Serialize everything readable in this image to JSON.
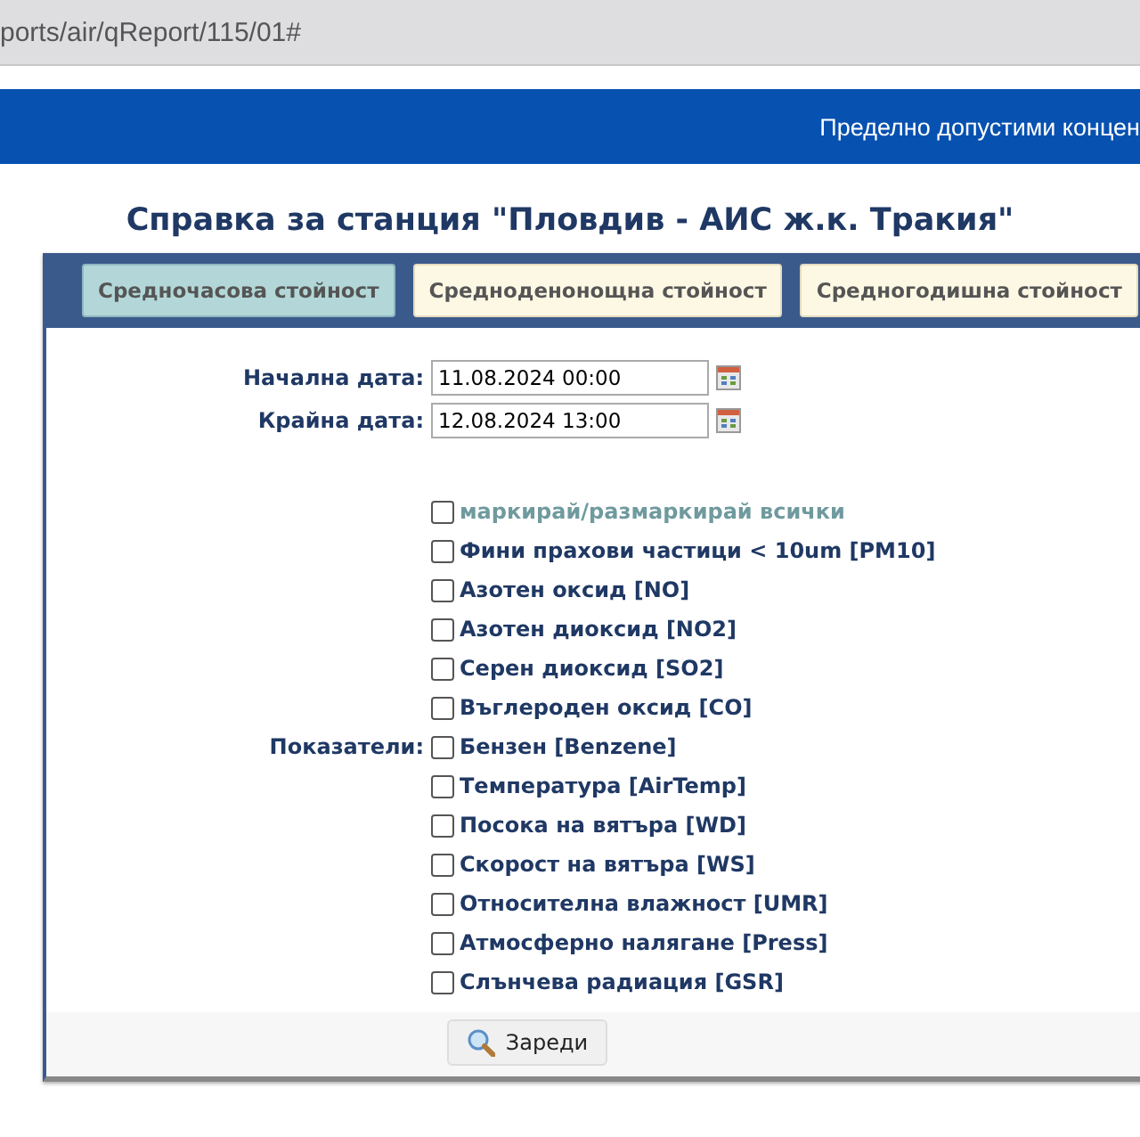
{
  "address_bar": {
    "url": "ports/air/qReport/115/01#"
  },
  "top_bar": {
    "text": "Пределно допустими концен"
  },
  "title": "Справка за станция \"Пловдив - АИС ж.к. Тракия\"",
  "tabs": [
    {
      "label": "Средночасова стойност",
      "selected": true
    },
    {
      "label": "Средноденонощна стойност",
      "selected": false
    },
    {
      "label": "Средногодишна стойност",
      "selected": false
    }
  ],
  "dates": [
    {
      "label": "Начална дата:",
      "value": "11.08.2024 00:00"
    },
    {
      "label": "Крайна дата:",
      "value": "12.08.2024 13:00"
    }
  ],
  "indicators": {
    "label": "Показатели:",
    "items": [
      {
        "label": "маркирай/размаркирай всички",
        "kind": "toggle-all",
        "checked": false
      },
      {
        "label": "Фини прахови частици < 10um [PM10]",
        "kind": "item",
        "checked": false
      },
      {
        "label": "Азотен оксид [NO]",
        "kind": "item",
        "checked": false
      },
      {
        "label": "Азотен диоксид [NO2]",
        "kind": "item",
        "checked": false
      },
      {
        "label": "Серен диоксид [SO2]",
        "kind": "item",
        "checked": false
      },
      {
        "label": "Въглероден оксид [CO]",
        "kind": "item",
        "checked": false
      },
      {
        "label": "Бензен [Benzene]",
        "kind": "item",
        "checked": false
      },
      {
        "label": "Температура [AirTemp]",
        "kind": "item",
        "checked": false
      },
      {
        "label": "Посока на вятъра [WD]",
        "kind": "item",
        "checked": false
      },
      {
        "label": "Скорост на вятъра [WS]",
        "kind": "item",
        "checked": false
      },
      {
        "label": "Относителна влажност [UMR]",
        "kind": "item",
        "checked": false
      },
      {
        "label": "Атмосферно налягане [Press]",
        "kind": "item",
        "checked": false
      },
      {
        "label": "Слънчева радиация [GSR]",
        "kind": "item",
        "checked": false
      }
    ]
  },
  "load_button": "Зареди"
}
